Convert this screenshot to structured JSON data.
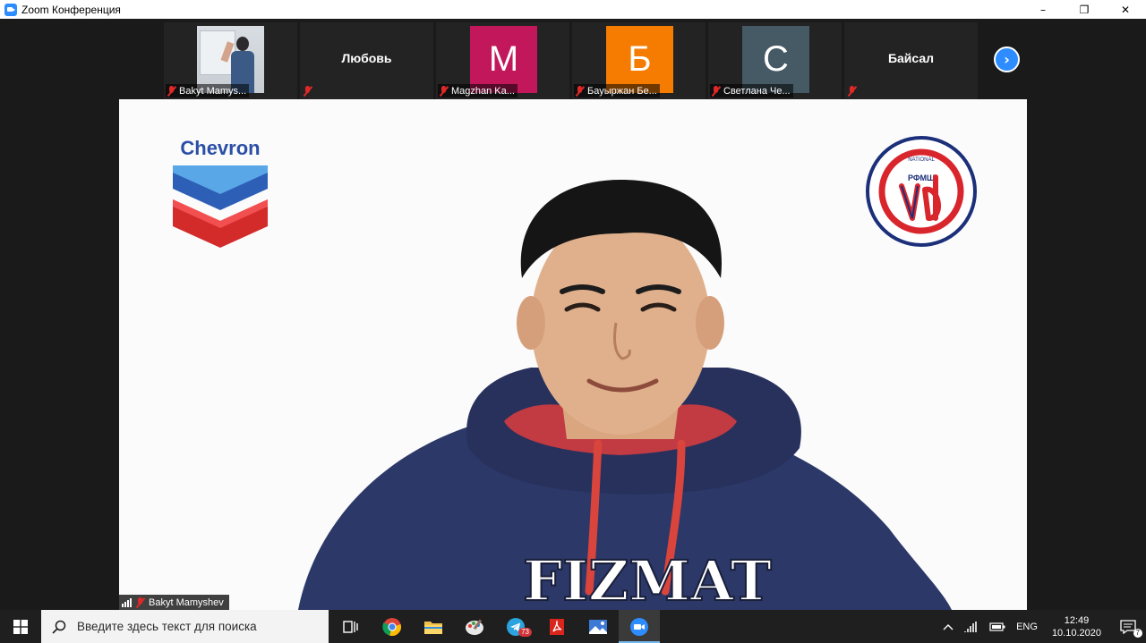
{
  "window": {
    "title": "Zoom Конференция",
    "minimize": "–",
    "maximize": "❐",
    "close": "✕"
  },
  "thumbnails": [
    {
      "type": "video",
      "label": "Bakyt Mamys..."
    },
    {
      "type": "name",
      "name": "Любовь",
      "label": ""
    },
    {
      "type": "avatar",
      "letter": "M",
      "color": "#c2185b",
      "label": "Magzhan Ka..."
    },
    {
      "type": "avatar",
      "letter": "Б",
      "color": "#f57c00",
      "label": "Бауыржан Бе..."
    },
    {
      "type": "avatar",
      "letter": "С",
      "color": "#455a64",
      "label": "Светлана Че..."
    },
    {
      "type": "name",
      "name": "Байсал",
      "label": ""
    }
  ],
  "next_button": "›",
  "main_video": {
    "speaker_name": "Bakyt Mamyshev",
    "logo_left_text": "Chevron",
    "logo_right_text": "РФМШ",
    "hoodie_text": "FIZMAT"
  },
  "taskbar": {
    "search_placeholder": "Введите здесь текст для поиска",
    "telegram_badge": "73",
    "language": "ENG",
    "time": "12:49",
    "date": "10.10.2020",
    "notification_count": "7"
  },
  "colors": {
    "zoom_blue": "#2d8cff",
    "muted_red": "#e02828",
    "hoodie_navy": "#2b3868"
  }
}
